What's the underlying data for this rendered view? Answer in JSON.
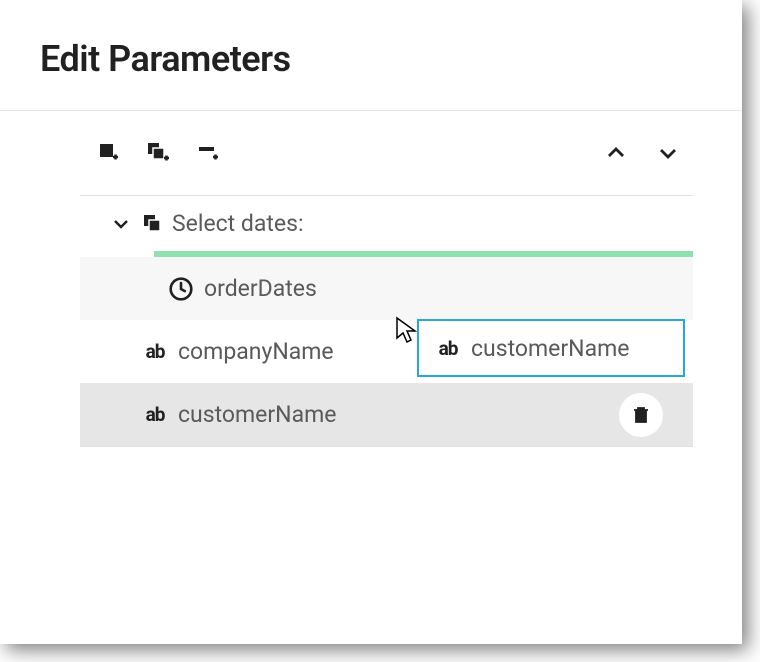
{
  "header": {
    "title": "Edit Parameters"
  },
  "group": {
    "label": "Select dates:"
  },
  "items": [
    {
      "label": "orderDates",
      "type": "clock"
    },
    {
      "label": "companyName",
      "type": "ab"
    },
    {
      "label": "customerName",
      "type": "ab"
    }
  ],
  "dragGhost": {
    "label": "customerName",
    "type": "ab"
  }
}
